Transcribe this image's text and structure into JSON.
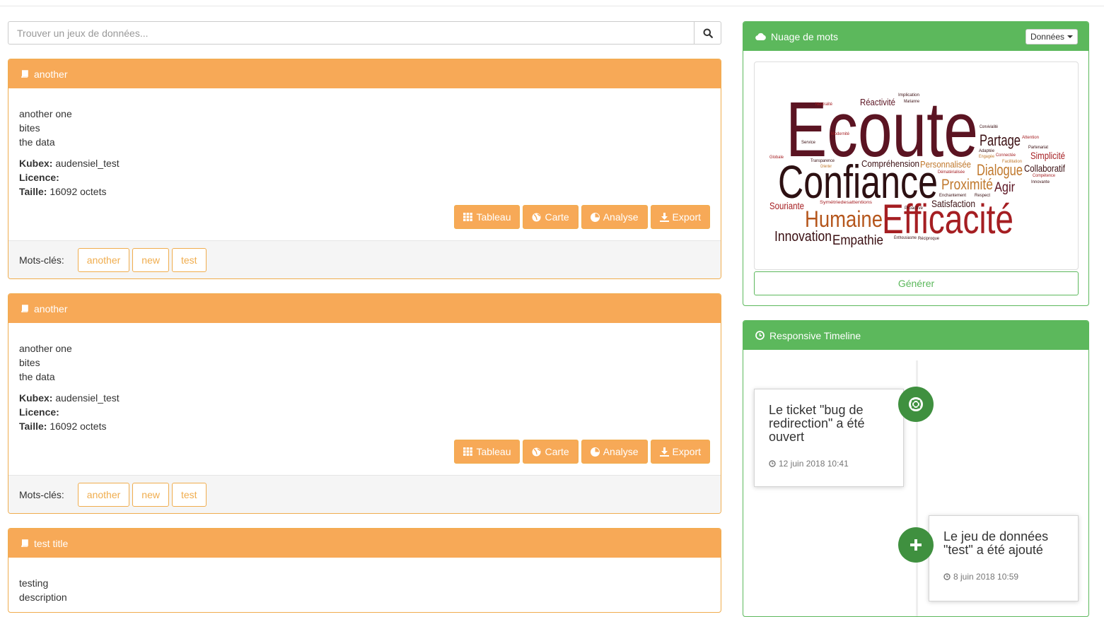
{
  "search": {
    "placeholder": "Trouver un jeux de données..."
  },
  "datasets": [
    {
      "title": "another",
      "description": [
        "another one",
        "bites",
        "the data"
      ],
      "kubex_label": "Kubex:",
      "kubex": "audensiel_test",
      "licence_label": "Licence:",
      "licence": "",
      "taille_label": "Taille:",
      "taille": "16092 octets",
      "actions": [
        "Tableau",
        "Carte",
        "Analyse",
        "Export"
      ],
      "keywords_label": "Mots-clés:",
      "keywords": [
        "another",
        "new",
        "test"
      ]
    },
    {
      "title": "another",
      "description": [
        "another one",
        "bites",
        "the data"
      ],
      "kubex_label": "Kubex:",
      "kubex": "audensiel_test",
      "licence_label": "Licence:",
      "licence": "",
      "taille_label": "Taille:",
      "taille": "16092 octets",
      "actions": [
        "Tableau",
        "Carte",
        "Analyse",
        "Export"
      ],
      "keywords_label": "Mots-clés:",
      "keywords": [
        "another",
        "new",
        "test"
      ]
    },
    {
      "title": "test title",
      "description": [
        "testing",
        "description"
      ]
    }
  ],
  "wordcloud": {
    "title": "Nuage de mots",
    "dropdown": "Données",
    "generate": "Générer",
    "words": [
      "Ecoute",
      "Confiance",
      "Efficacité",
      "Humaine",
      "Partage",
      "Dialogue",
      "Proximité",
      "Innovation",
      "Empathie",
      "Agir",
      "Compréhension",
      "Personnalisée",
      "Simplicité",
      "Collaboratif",
      "Satisfaction",
      "Souriante",
      "Réactivité",
      "Implication",
      "Marianne",
      "Neutralité",
      "Convivialité",
      "Modernité",
      "Service",
      "Attention",
      "Partenariat",
      "Adaptée",
      "Engagée",
      "Connectée",
      "Facilitation",
      "Compétence",
      "Innovante",
      "Globale",
      "Transparence",
      "Orienter",
      "Dématérialisée",
      "Enchantement",
      "Respect",
      "Symétriedesattentions",
      "Proactive",
      "Enthousiasme",
      "Réciproque"
    ]
  },
  "timeline": {
    "title": "Responsive Timeline",
    "events": [
      {
        "text": "Le ticket \"bug de redirection\" a été ouvert",
        "date": "12 juin 2018 10:41",
        "icon": "life-ring-icon"
      },
      {
        "text": "Le jeu de données \"test\" a été ajouté",
        "date": "8 juin 2018 10:59",
        "icon": "plus-icon"
      }
    ]
  },
  "colors": {
    "orange": "#f7a957",
    "orange_border": "#f0ad4e",
    "green": "#5cb85c",
    "badge_green": "#3f903f",
    "wine": "#5b1422",
    "rust": "#b5561c"
  }
}
